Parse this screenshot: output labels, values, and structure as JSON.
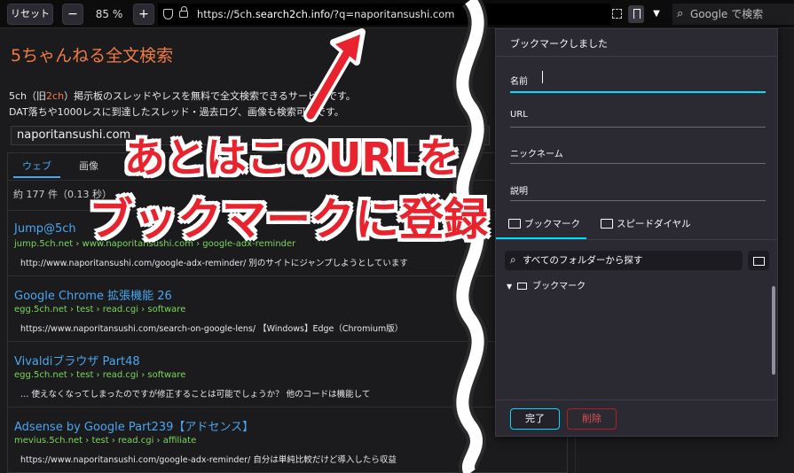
{
  "toolbar": {
    "reset_label": "リセット",
    "zoom_out_label": "−",
    "zoom_level": "85 %",
    "zoom_in_label": "+",
    "url_prefix": "https://5ch.",
    "url_domain": "search2ch.info",
    "url_suffix": "/?q=naporitansushi.com",
    "search_placeholder": "Google で検索"
  },
  "page": {
    "title": "5ちゃんねる全文検索",
    "desc1_a": "5ch（旧",
    "desc1_hl": "2ch",
    "desc1_b": "）掲示板のスレッドやレスを無料で全文検索できるサービスです。",
    "desc2": "DAT落ちや1000レスに到達したスレッド・過去ログ、画像も検索可能です。",
    "query": "naporitansushi.com",
    "tabs": [
      "ウェブ",
      "画像"
    ],
    "result_count": "約 177 件（0.13 秒）",
    "results": [
      {
        "title": "Jump@5ch",
        "url": "jump.5ch.net › www.naporitansushi.com › google-adx-reminder",
        "snippet": "http://www.naporitansushi.com/google-adx-reminder/ 別のサイトにジャンプしようとしています"
      },
      {
        "title": "Google Chrome 拡張機能 26",
        "url": "egg.5ch.net › test › read.cgi › software",
        "snippet": "https://www.naporitansushi.com/search-on-google-lens/ 【Windows】Edge（Chromium版）"
      },
      {
        "title": "Vivaldiブラウザ Part48",
        "url": "egg.5ch.net › test › read.cgi › software",
        "snippet": "… 使えなくなってしまったのですが修正することは可能でしょうか？ 他のコードは機能して"
      },
      {
        "title": "Adsense by Google Part239【アドセンス】",
        "url": "mevius.5ch.net › test › read.cgi › affiliate",
        "snippet": "https://www.naporitansushi.com/google-adx-reminder/ 自分は単純比較だけど導入したら収益"
      }
    ]
  },
  "panel": {
    "title": "ブックマークしました",
    "name_label": "名前",
    "url_label": "URL",
    "nickname_label": "ニックネーム",
    "description_label": "説明",
    "tab_bookmark": "ブックマーク",
    "tab_speed_dial": "スピードダイヤル",
    "folder_search": "すべてのフォルダーから探す",
    "tree_item": "ブックマーク",
    "done_label": "完了",
    "delete_label": "削除"
  },
  "overlay": {
    "line1": "あとはこのURLを",
    "line2": "ブックマークに登録"
  },
  "colors": {
    "accent": "#00ddff",
    "link": "#4aa6ef",
    "url_green": "#7ad75c",
    "title_orange": "#f07b45",
    "overlay_red": "#e8232d"
  }
}
